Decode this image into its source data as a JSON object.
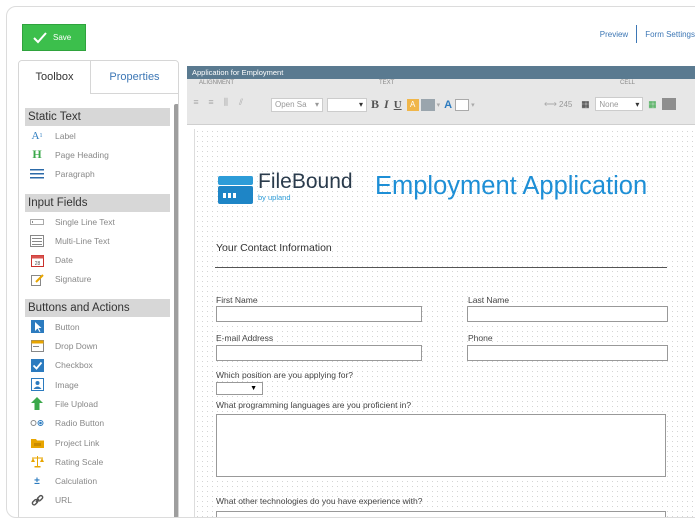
{
  "toolbar": {
    "save_label": "Save",
    "preview_label": "Preview",
    "form_settings_label": "Form Settings"
  },
  "left_panel": {
    "tabs": [
      "Toolbox",
      "Properties"
    ],
    "sections": [
      {
        "title": "Static Text",
        "items": [
          {
            "label": "Label",
            "icon": "label-icon"
          },
          {
            "label": "Page Heading",
            "icon": "heading-icon"
          },
          {
            "label": "Paragraph",
            "icon": "paragraph-icon"
          }
        ]
      },
      {
        "title": "Input Fields",
        "items": [
          {
            "label": "Single Line Text",
            "icon": "single-line-icon"
          },
          {
            "label": "Multi-Line Text",
            "icon": "multi-line-icon"
          },
          {
            "label": "Date",
            "icon": "calendar-icon"
          },
          {
            "label": "Signature",
            "icon": "signature-icon"
          }
        ]
      },
      {
        "title": "Buttons and Actions",
        "items": [
          {
            "label": "Button",
            "icon": "button-icon"
          },
          {
            "label": "Drop Down",
            "icon": "dropdown-icon"
          },
          {
            "label": "Checkbox",
            "icon": "checkbox-icon"
          },
          {
            "label": "Image",
            "icon": "image-icon"
          },
          {
            "label": "File Upload",
            "icon": "upload-icon"
          },
          {
            "label": "Radio Button",
            "icon": "radio-icon"
          },
          {
            "label": "Project Link",
            "icon": "folder-icon"
          },
          {
            "label": "Rating Scale",
            "icon": "scale-icon"
          },
          {
            "label": "Calculation",
            "icon": "calculator-icon"
          },
          {
            "label": "URL",
            "icon": "link-icon"
          }
        ]
      }
    ]
  },
  "editor": {
    "title": "Application for Employment",
    "ribbon": {
      "alignment_label": "ALIGNMENT",
      "text_label": "TEXT",
      "cell_label": "CELL",
      "font": "Open Sa",
      "size": "",
      "cell_width": "245",
      "border": "None",
      "highlight_letter": "A",
      "font_color_letter": "A"
    },
    "form": {
      "logo_name": "FileBound",
      "logo_sub": "by upland",
      "title": "Employment Application",
      "section_title": "Your Contact Information",
      "first_name_label": "First Name",
      "last_name_label": "Last Name",
      "email_label": "E-mail Address",
      "phone_label": "Phone",
      "position_label": "Which position are you applying for?",
      "languages_label": "What programming languages are you proficient in?",
      "technologies_label": "What other technologies do you have experience with?"
    }
  }
}
